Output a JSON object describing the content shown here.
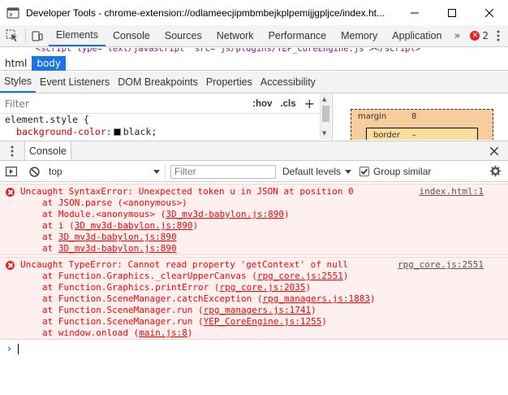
{
  "window": {
    "title": "Developer Tools - chrome-extension://odlameecjipmbmbejkplpemijjgpljce/index.ht..."
  },
  "main_tabs": [
    {
      "label": "Elements",
      "active": true
    },
    {
      "label": "Console",
      "active": false
    },
    {
      "label": "Sources",
      "active": false
    },
    {
      "label": "Network",
      "active": false
    },
    {
      "label": "Performance",
      "active": false
    },
    {
      "label": "Memory",
      "active": false
    },
    {
      "label": "Application",
      "active": false
    }
  ],
  "more_tabs_label": "»",
  "error_count": "2",
  "breadcrumbs": [
    {
      "label": "html",
      "selected": false
    },
    {
      "label": "body",
      "selected": true
    }
  ],
  "styles_tabs": [
    {
      "label": "Styles",
      "active": true
    },
    {
      "label": "Event Listeners",
      "active": false
    },
    {
      "label": "DOM Breakpoints",
      "active": false
    },
    {
      "label": "Properties",
      "active": false
    },
    {
      "label": "Accessibility",
      "active": false
    }
  ],
  "styles": {
    "filter_placeholder": "Filter",
    "hov_label": ":hov",
    "cls_label": ".cls",
    "add_label": "+",
    "rule_selector": "element.style {",
    "rule_property": "background-color:",
    "rule_value": "black;"
  },
  "box_model": {
    "margin_label": "margin",
    "margin_value": "8",
    "border_label": "border",
    "border_value": "–"
  },
  "drawer": {
    "tab_label": "Console"
  },
  "console_toolbar": {
    "context": "top",
    "filter_placeholder": "Filter",
    "levels_label": "Default levels",
    "group_label": "Group similar",
    "group_checked": true
  },
  "messages": [
    {
      "text": "Uncaught SyntaxError: Unexpected token u in JSON at position 0",
      "source": "index.html:1",
      "frames": [
        {
          "prefix": "at JSON.parse (<anonymous>)",
          "loc": "",
          "suffix": ""
        },
        {
          "prefix": "at Module.<anonymous> (",
          "loc": "3D_mv3d-babylon.js:890",
          "suffix": ")"
        },
        {
          "prefix": "at i (",
          "loc": "3D_mv3d-babylon.js:890",
          "suffix": ")"
        },
        {
          "prefix": "at ",
          "loc": "3D_mv3d-babylon.js:890",
          "suffix": ""
        },
        {
          "prefix": "at ",
          "loc": "3D_mv3d-babylon.js:890",
          "suffix": ""
        }
      ]
    },
    {
      "text": "Uncaught TypeError: Cannot read property 'getContext' of null",
      "source": "rpg_core.js:2551",
      "frames": [
        {
          "prefix": "at Function.Graphics._clearUpperCanvas (",
          "loc": "rpg_core.js:2551",
          "suffix": ")"
        },
        {
          "prefix": "at Function.Graphics.printError (",
          "loc": "rpg_core.js:2035",
          "suffix": ")"
        },
        {
          "prefix": "at Function.SceneManager.catchException (",
          "loc": "rpg_managers.js:1883",
          "suffix": ")"
        },
        {
          "prefix": "at Function.SceneManager.run (",
          "loc": "rpg_managers.js:1741",
          "suffix": ")"
        },
        {
          "prefix": "at Function.SceneManager.run (",
          "loc": "YEP_CoreEngine.js:1255",
          "suffix": ")"
        },
        {
          "prefix": "at window.onload (",
          "loc": "main.js:8",
          "suffix": ")"
        }
      ]
    }
  ],
  "prompt_symbol": "›",
  "colors": {
    "accent": "#1a73e8",
    "error_red": "#e0252b",
    "error_bg": "#fff0f0"
  }
}
